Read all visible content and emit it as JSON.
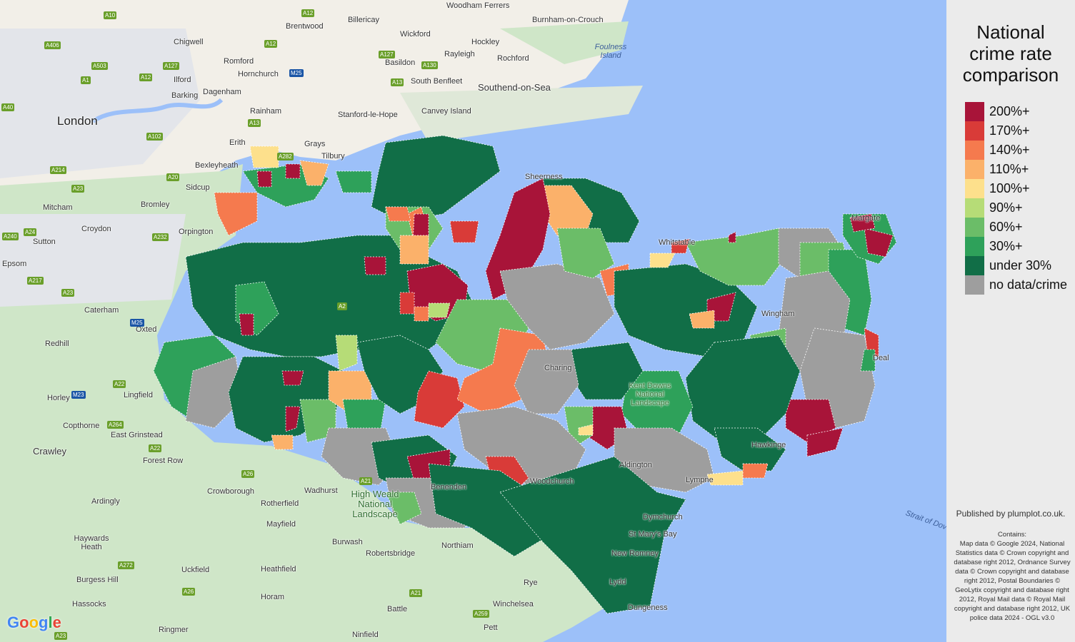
{
  "map": {
    "colors": {
      "water": "#9cc0f9",
      "land": "#f3f2ee",
      "green_land": "#c8e6c0",
      "urban": "#e1e4e8"
    },
    "places": [
      {
        "name": "London",
        "size": "big"
      },
      {
        "name": "Woodham Ferrers"
      },
      {
        "name": "Burnham-on-Crouch"
      },
      {
        "name": "Chigwell"
      },
      {
        "name": "Brentwood"
      },
      {
        "name": "Billericay"
      },
      {
        "name": "Wickford"
      },
      {
        "name": "Hockley"
      },
      {
        "name": "Rayleigh"
      },
      {
        "name": "Rochford"
      },
      {
        "name": "Foulness Island",
        "type": "water"
      },
      {
        "name": "Romford"
      },
      {
        "name": "Hornchurch"
      },
      {
        "name": "Basildon"
      },
      {
        "name": "Ilford"
      },
      {
        "name": "Barking"
      },
      {
        "name": "Dagenham"
      },
      {
        "name": "South Benfleet"
      },
      {
        "name": "Southend-on-Sea"
      },
      {
        "name": "Rainham"
      },
      {
        "name": "Stanford-le-Hope"
      },
      {
        "name": "Canvey Island"
      },
      {
        "name": "Erith"
      },
      {
        "name": "Grays"
      },
      {
        "name": "Tilbury"
      },
      {
        "name": "Bexleyheath"
      },
      {
        "name": "Sidcup"
      },
      {
        "name": "Bromley"
      },
      {
        "name": "Mitcham"
      },
      {
        "name": "Croydon"
      },
      {
        "name": "Orpington"
      },
      {
        "name": "Sutton"
      },
      {
        "name": "Epsom"
      },
      {
        "name": "Caterham"
      },
      {
        "name": "Oxted"
      },
      {
        "name": "Redhill"
      },
      {
        "name": "Horley"
      },
      {
        "name": "Lingfield"
      },
      {
        "name": "Copthorne"
      },
      {
        "name": "East Grinstead"
      },
      {
        "name": "Crawley"
      },
      {
        "name": "Forest Row"
      },
      {
        "name": "Crowborough"
      },
      {
        "name": "Wadhurst"
      },
      {
        "name": "Ardingly"
      },
      {
        "name": "Rotherfield"
      },
      {
        "name": "Haywards Heath"
      },
      {
        "name": "Mayfield"
      },
      {
        "name": "Burwash"
      },
      {
        "name": "Robertsbridge"
      },
      {
        "name": "Northiam"
      },
      {
        "name": "Heathfield"
      },
      {
        "name": "Uckfield"
      },
      {
        "name": "Burgess Hill"
      },
      {
        "name": "Hassocks"
      },
      {
        "name": "Horam"
      },
      {
        "name": "Battle"
      },
      {
        "name": "Winchelsea"
      },
      {
        "name": "Rye"
      },
      {
        "name": "Ringmer"
      },
      {
        "name": "Ninfield"
      },
      {
        "name": "Pett"
      },
      {
        "name": "Dymchurch"
      },
      {
        "name": "St Mary's Bay"
      },
      {
        "name": "New Romney"
      },
      {
        "name": "Lydd"
      },
      {
        "name": "Dungeness"
      },
      {
        "name": "Aldington"
      },
      {
        "name": "Lympne"
      },
      {
        "name": "Hawkinge"
      },
      {
        "name": "Benenden"
      },
      {
        "name": "Woodchurch"
      },
      {
        "name": "Wingham"
      },
      {
        "name": "Charing"
      },
      {
        "name": "Whitstable"
      },
      {
        "name": "Margate"
      },
      {
        "name": "Sheerness"
      },
      {
        "name": "Deal"
      },
      {
        "name": "Kent Downs National Landscape"
      },
      {
        "name": "High Weald National Landscape"
      },
      {
        "name": "Strait of Dover",
        "type": "water"
      }
    ],
    "roads": [
      "A10",
      "A12",
      "A406",
      "A503",
      "A1",
      "A12",
      "A127",
      "A12",
      "M25",
      "A127",
      "A130",
      "A13",
      "A13",
      "A40",
      "A102",
      "A282",
      "A214",
      "A20",
      "A23",
      "A24",
      "A232",
      "A240",
      "A217",
      "A23",
      "M25",
      "M23",
      "A22",
      "A264",
      "A22",
      "A26",
      "A21",
      "A26",
      "A272",
      "A23",
      "A21",
      "A259",
      "A2"
    ]
  },
  "legend": {
    "title_lines": [
      "National",
      "crime rate",
      "comparison"
    ],
    "items": [
      {
        "label": "200%+",
        "color": "#a81439"
      },
      {
        "label": "170%+",
        "color": "#d93b38"
      },
      {
        "label": "140%+",
        "color": "#f57a4e"
      },
      {
        "label": "110%+",
        "color": "#fbb16a"
      },
      {
        "label": "100%+",
        "color": "#fde08c"
      },
      {
        "label": "90%+",
        "color": "#b6dc77"
      },
      {
        "label": "60%+",
        "color": "#6bbd68"
      },
      {
        "label": "30%+",
        "color": "#2ea15a"
      },
      {
        "label": "under 30%",
        "color": "#116e47"
      },
      {
        "label": "no data/crime",
        "color": "#9e9e9e"
      }
    ]
  },
  "footer": {
    "published": "Published by plumplot.co.uk.",
    "contains_title": "Contains:",
    "contains_text": "Map data © Google 2024, National Statistics data © Crown copyright and database right 2012, Ordnance Survey data © Crown copyright and database right 2012, Postal Boundaries © GeoLytix copyright and database right 2012, Royal Mail data © Royal Mail copyright and database right 2012, UK police data 2024 - OGL v3.0",
    "google_logo": "Google"
  }
}
